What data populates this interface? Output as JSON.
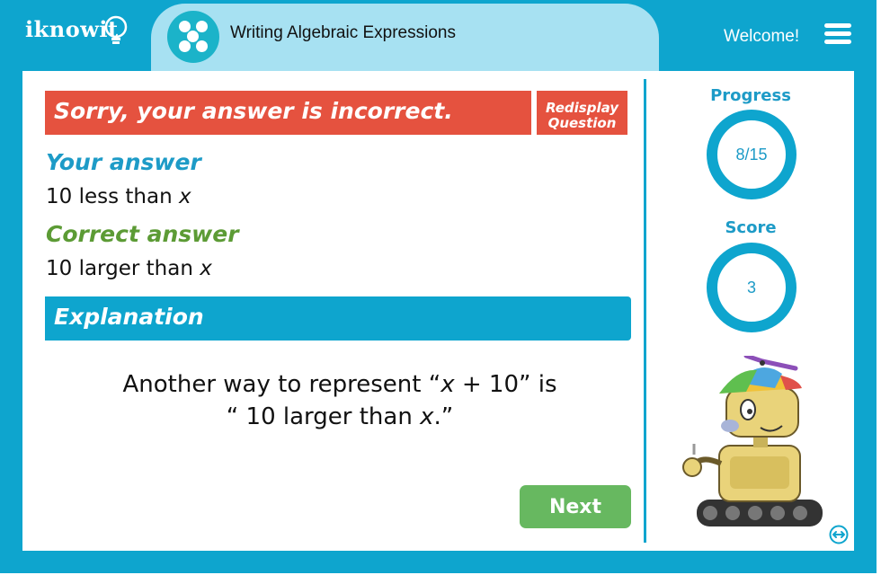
{
  "header": {
    "logo_text": "iknowit",
    "lesson_title": "Writing Algebraic Expressions",
    "welcome": "Welcome!"
  },
  "feedback": {
    "banner": "Sorry, your answer is incorrect.",
    "redisplay_line1": "Redisplay",
    "redisplay_line2": "Question",
    "your_answer_label": "Your answer",
    "your_answer_text": "10 less than ",
    "your_answer_var": "x",
    "correct_answer_label": "Correct answer",
    "correct_answer_text": "10 larger than ",
    "correct_answer_var": "x"
  },
  "explanation": {
    "heading": "Explanation",
    "line1_pre": "Another way to represent “",
    "line1_var": "x",
    "line1_post": " + 10” is",
    "line2_pre": "“ 10 larger than ",
    "line2_var": "x",
    "line2_post": ".”"
  },
  "actions": {
    "next": "Next"
  },
  "sidebar": {
    "progress_label": "Progress",
    "progress_value": "8/15",
    "score_label": "Score",
    "score_value": "3"
  },
  "colors": {
    "frame": "#0ea5ce",
    "incorrect": "#e5523f",
    "your_answer": "#1d9bc7",
    "correct_answer": "#5c9b35",
    "next_button": "#67b860"
  },
  "icons": {
    "menu": "hamburger-icon",
    "lesson": "dots-circle-icon",
    "resize": "double-arrow-icon"
  }
}
